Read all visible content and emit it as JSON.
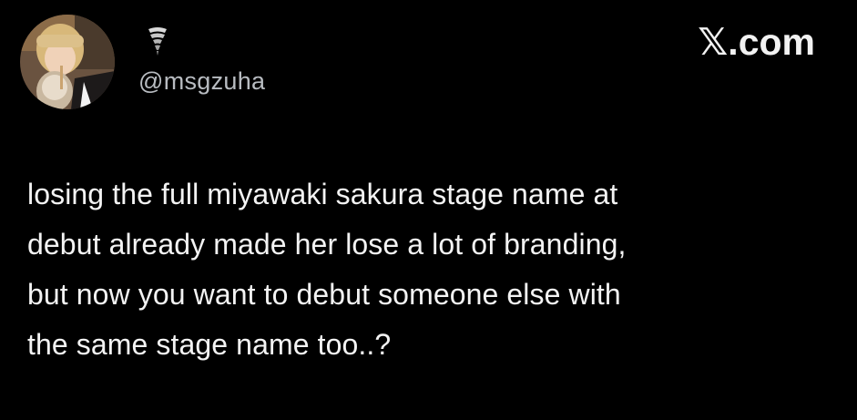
{
  "profile": {
    "handle": "@msgzuha",
    "avatar_icon": "profile-photo",
    "display_name_icon": "tornado-emoji-icon"
  },
  "brand": {
    "label": "𝕏.com"
  },
  "tweet": {
    "lines": [
      "losing the full miyawaki sakura stage name at",
      "debut already made her lose a lot of branding,",
      "but now you want to debut someone else with",
      "the same stage name too..?"
    ]
  },
  "colors": {
    "background": "#000000",
    "text": "#f3f3f3",
    "handle": "#b8bcc1"
  }
}
